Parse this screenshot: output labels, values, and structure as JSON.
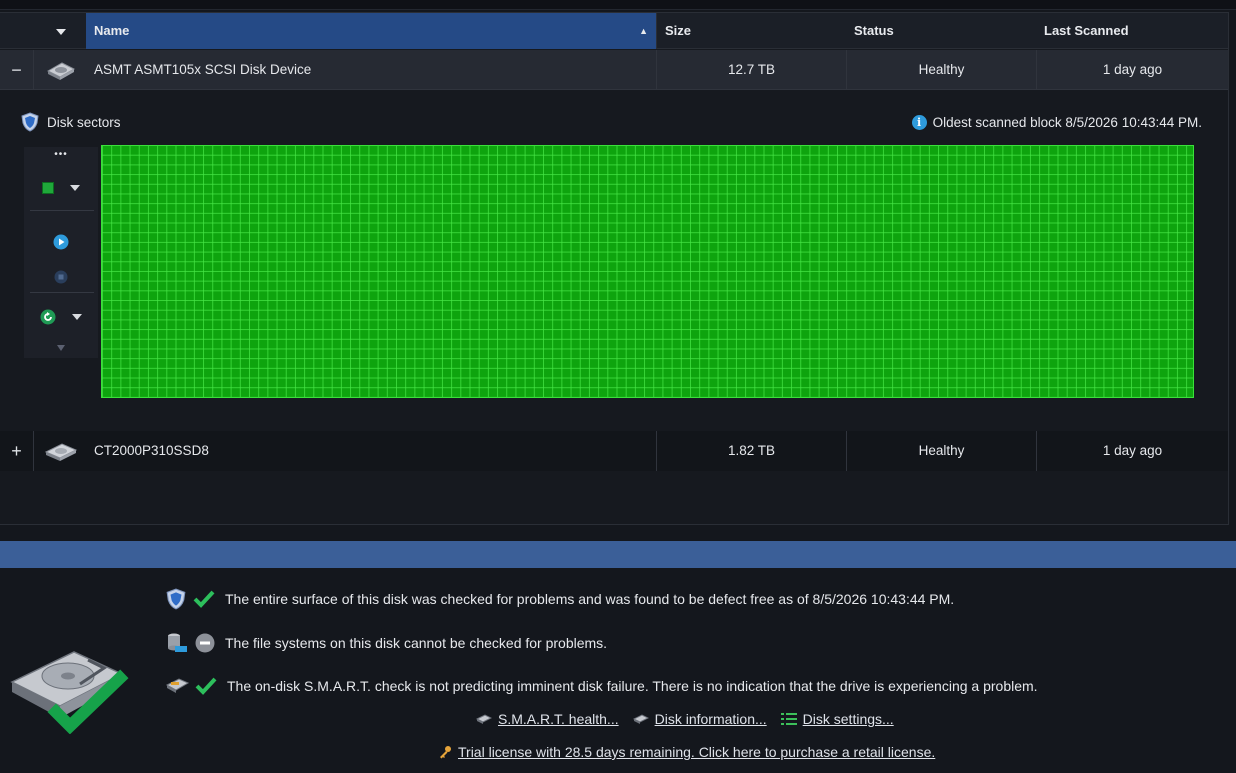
{
  "table": {
    "columns": {
      "name": "Name",
      "size": "Size",
      "status": "Status",
      "last_scanned": "Last Scanned"
    },
    "sort": "ascending",
    "rows": [
      {
        "toggle": "−",
        "name": "ASMT ASMT105x SCSI Disk Device",
        "size": "12.7 TB",
        "status": "Healthy",
        "last_scanned": "1 day ago",
        "expanded": true
      },
      {
        "toggle": "+",
        "name": "CT2000P310SSD8",
        "size": "1.82 TB",
        "status": "Healthy",
        "last_scanned": "1 day ago",
        "expanded": false
      }
    ]
  },
  "sectors": {
    "title": "Disk sectors",
    "oldest": "Oldest scanned block 8/5/2026 10:43:44 PM.",
    "grid_color": "#0ea40e",
    "grid_line_color": "#46e646"
  },
  "toolbar": {
    "more": "•••",
    "icons": [
      "legend-square-icon",
      "play-icon",
      "stop-icon",
      "refresh-icon",
      "collapse-icon"
    ]
  },
  "summary": {
    "surface": "The entire surface of this disk was checked for problems and was found to be defect free as of 8/5/2026 10:43:44 PM.",
    "filesystems": "The file systems on this disk cannot be checked for problems.",
    "smart": "The on-disk S.M.A.R.T. check is not predicting imminent disk failure. There is no indication that the drive is experiencing a problem."
  },
  "links": {
    "smart_health": "S.M.A.R.T. health...",
    "disk_info": "Disk information...",
    "disk_settings": "Disk settings..."
  },
  "trial": "Trial license with 28.5 days remaining. Click here to purchase a retail license.",
  "colors": {
    "accent": "#254a86",
    "status_bar": "#3b5f98",
    "ok_green": "#2dbf5c",
    "info_blue": "#2e9bdc"
  }
}
